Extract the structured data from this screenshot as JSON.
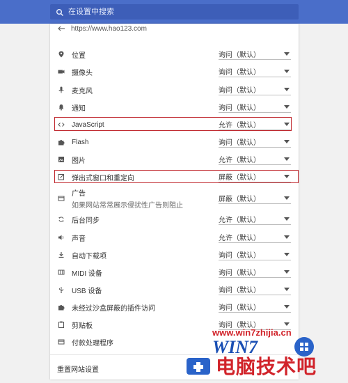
{
  "search": {
    "placeholder": "在设置中搜索"
  },
  "site": {
    "url": "https://www.hao123.com"
  },
  "permissions": [
    {
      "label": "位置",
      "value": "询问（默认）",
      "icon": "location-icon"
    },
    {
      "label": "摄像头",
      "value": "询问（默认）",
      "icon": "camera-icon"
    },
    {
      "label": "麦克风",
      "value": "询问（默认）",
      "icon": "microphone-icon"
    },
    {
      "label": "通知",
      "value": "询问（默认）",
      "icon": "bell-icon"
    },
    {
      "label": "JavaScript",
      "value": "允许（默认）",
      "icon": "code-icon"
    },
    {
      "label": "Flash",
      "value": "询问（默认）",
      "icon": "puzzle-icon"
    },
    {
      "label": "图片",
      "value": "允许（默认）",
      "icon": "image-icon"
    },
    {
      "label": "弹出式窗口和重定向",
      "value": "屏蔽（默认）",
      "icon": "popup-icon"
    },
    {
      "label": "广告",
      "sublabel": "如果网站常常展示侵扰性广告则阻止",
      "value": "屏蔽（默认）",
      "icon": "ads-icon"
    },
    {
      "label": "后台同步",
      "value": "允许（默认）",
      "icon": "sync-icon"
    },
    {
      "label": "声音",
      "value": "允许（默认）",
      "icon": "sound-icon"
    },
    {
      "label": "自动下载项",
      "value": "询问（默认）",
      "icon": "download-icon"
    },
    {
      "label": "MIDI 设备",
      "value": "询问（默认）",
      "icon": "midi-icon"
    },
    {
      "label": "USB 设备",
      "value": "询问（默认）",
      "icon": "usb-icon"
    },
    {
      "label": "未经过沙盒屏蔽的插件访问",
      "value": "询问（默认）",
      "icon": "puzzle-icon"
    },
    {
      "label": "剪贴板",
      "value": "询问（默认）",
      "icon": "clipboard-icon"
    },
    {
      "label": "付款处理程序",
      "value": "",
      "icon": "payment-icon"
    }
  ],
  "reset_label": "重置网站设置",
  "watermark": {
    "url": "www.win7zhijia.cn",
    "brand": "WIN7",
    "text": "电脑技术吧"
  },
  "colors": {
    "header": "#4a6ec9",
    "highlight": "#c0272d"
  }
}
